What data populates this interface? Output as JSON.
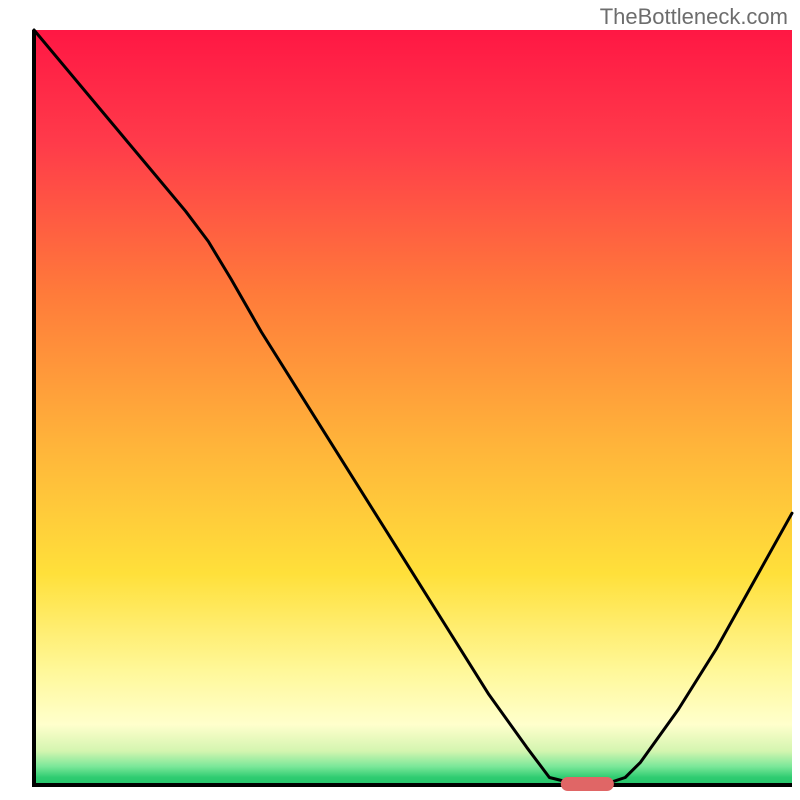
{
  "watermark": "TheBottleneck.com",
  "chart_data": {
    "type": "line",
    "title": "",
    "xlabel": "",
    "ylabel": "",
    "xlim": [
      0,
      100
    ],
    "ylim": [
      0,
      100
    ],
    "x": [
      0,
      5,
      10,
      15,
      20,
      23,
      26,
      30,
      35,
      40,
      45,
      50,
      55,
      60,
      65,
      68,
      72,
      75,
      78,
      80,
      85,
      90,
      95,
      100
    ],
    "values": [
      100,
      94,
      88,
      82,
      76,
      72,
      67,
      60,
      52,
      44,
      36,
      28,
      20,
      12,
      5,
      1,
      0,
      0,
      1,
      3,
      10,
      18,
      27,
      36
    ],
    "minimum_marker": {
      "x_center": 73,
      "width": 7,
      "color": "#e06666"
    },
    "background": {
      "type": "gradient-vertical",
      "stops": [
        {
          "pos": 0.0,
          "color": "#ff1744"
        },
        {
          "pos": 0.15,
          "color": "#ff3b4a"
        },
        {
          "pos": 0.35,
          "color": "#ff7b3a"
        },
        {
          "pos": 0.55,
          "color": "#ffb43a"
        },
        {
          "pos": 0.72,
          "color": "#ffe03a"
        },
        {
          "pos": 0.85,
          "color": "#fff89a"
        },
        {
          "pos": 0.92,
          "color": "#ffffcc"
        },
        {
          "pos": 0.955,
          "color": "#d4f5b0"
        },
        {
          "pos": 0.975,
          "color": "#7de89a"
        },
        {
          "pos": 0.99,
          "color": "#2ecc71"
        },
        {
          "pos": 1.0,
          "color": "#27c46b"
        }
      ]
    },
    "axis_color": "#000000"
  }
}
